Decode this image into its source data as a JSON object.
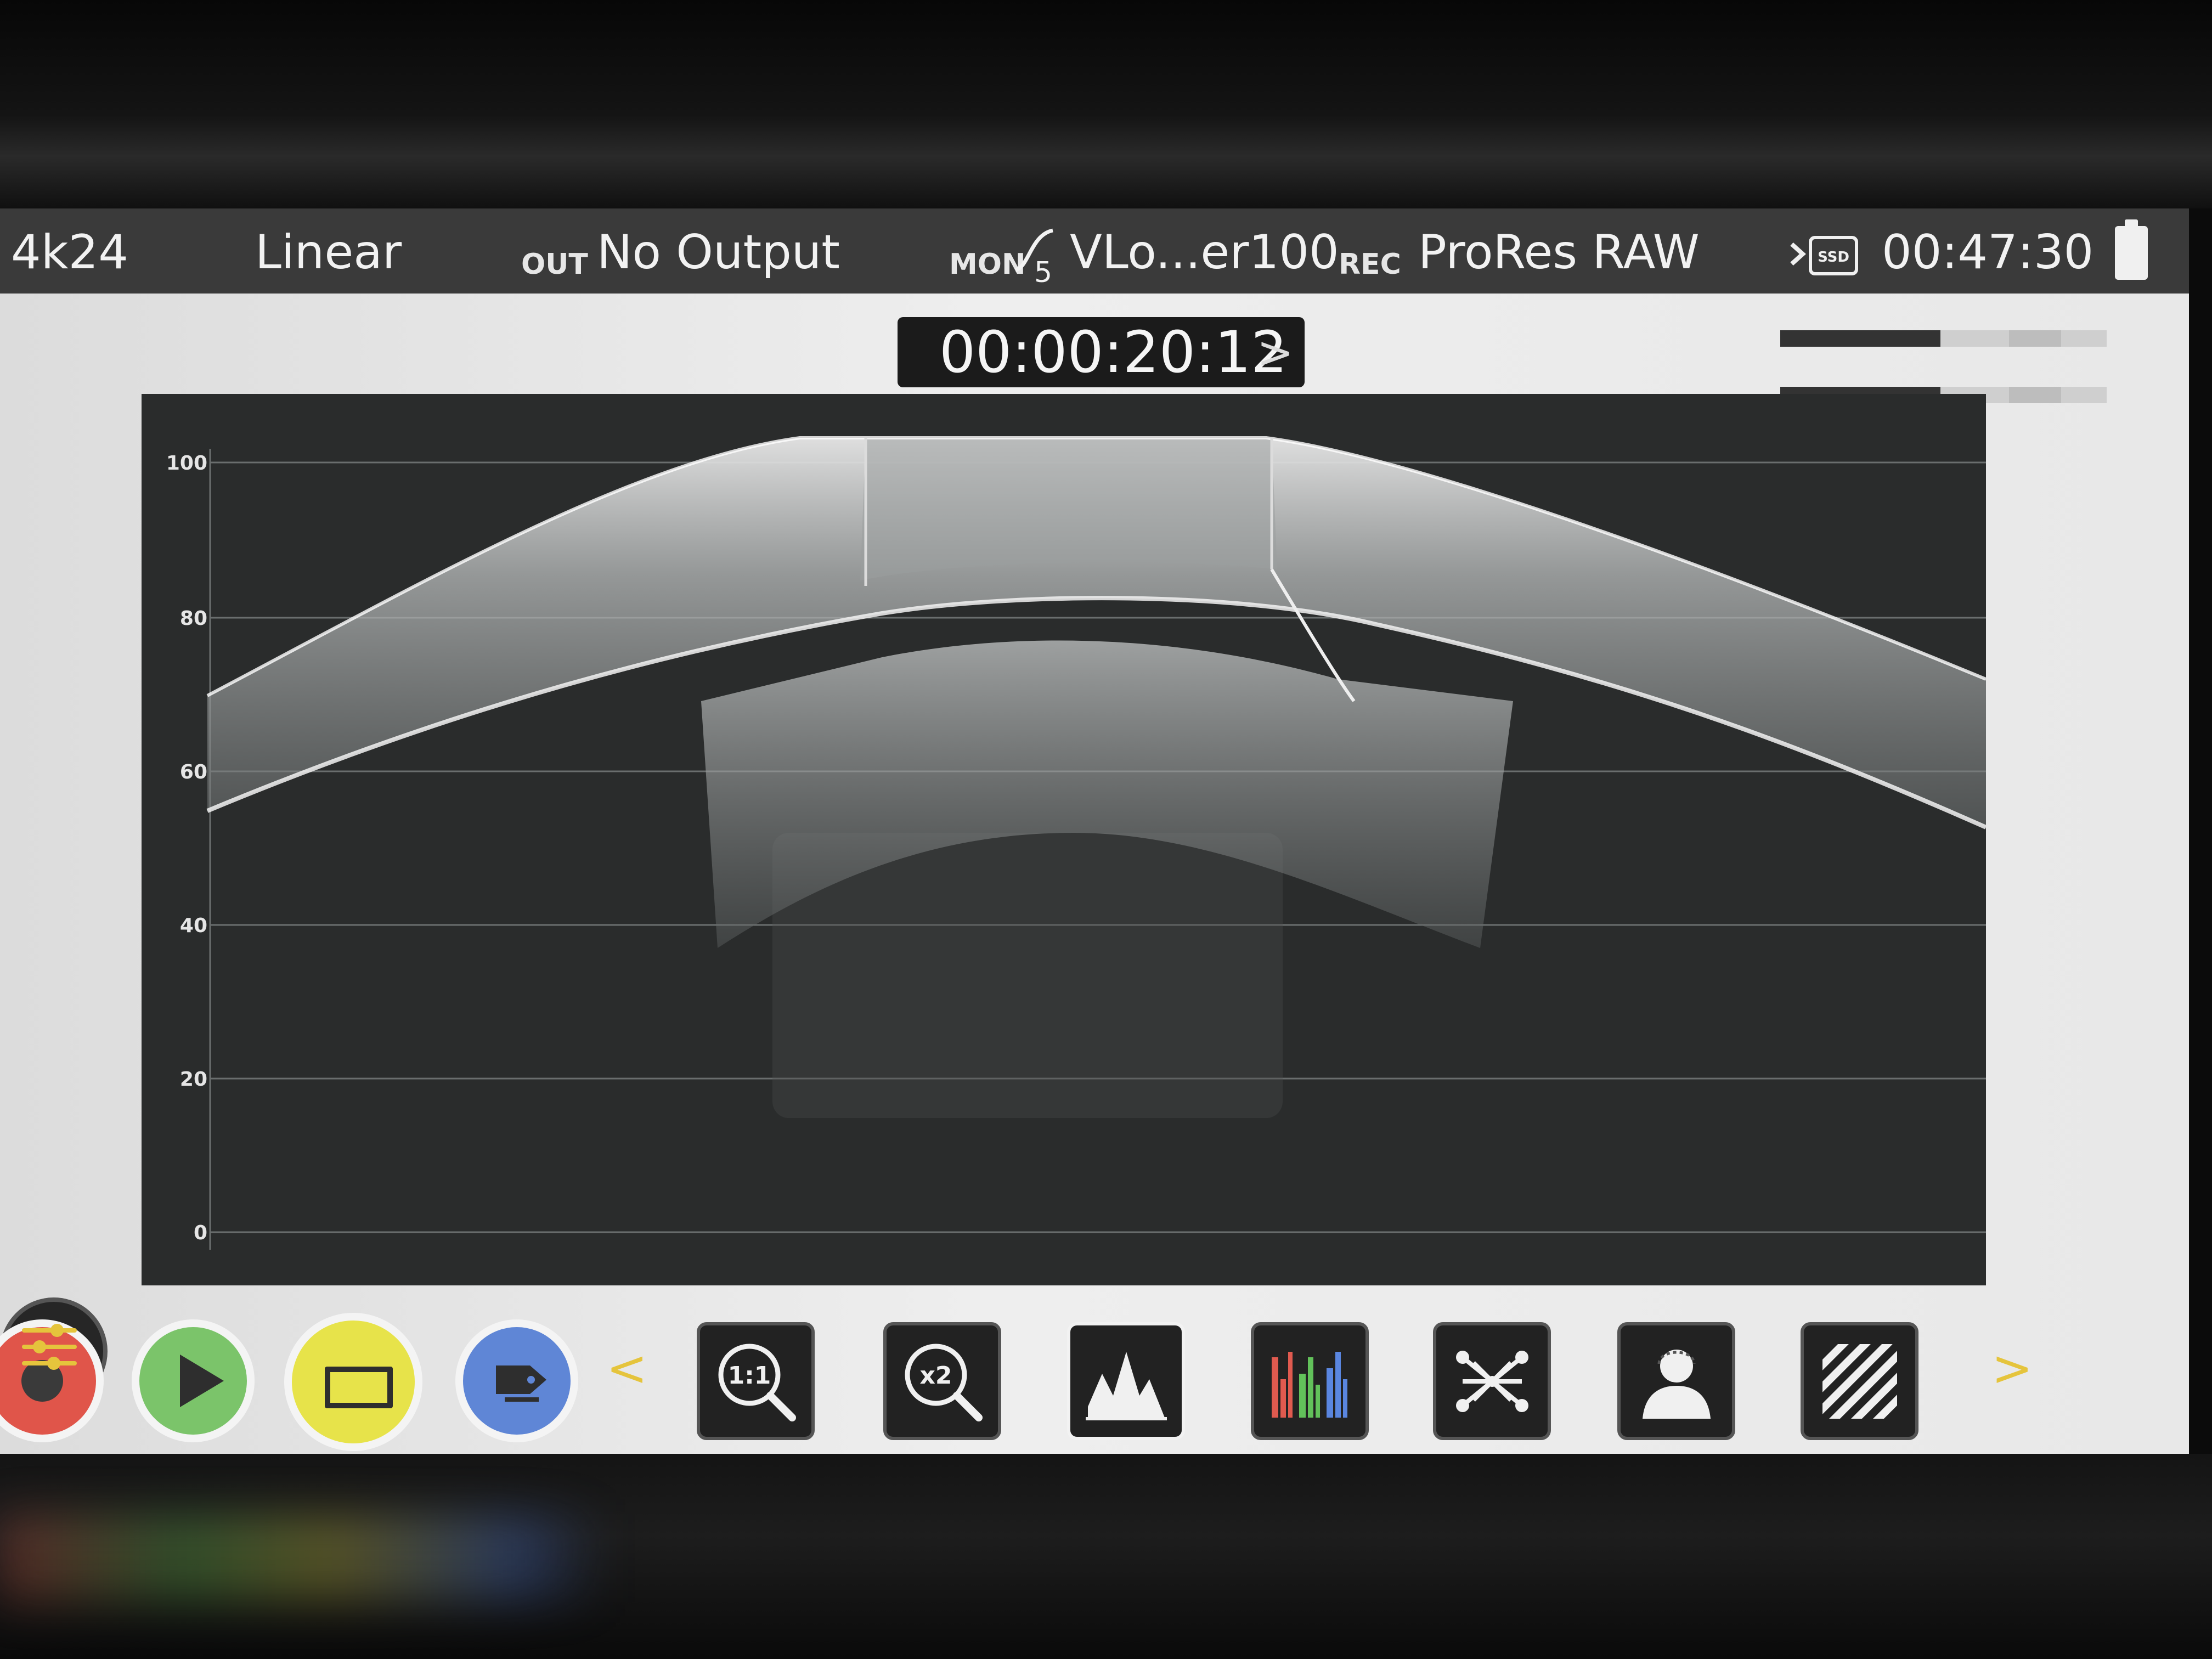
{
  "status_bar": {
    "resolution": "4k24",
    "gamma": "Linear",
    "out_label": "OUT",
    "output": "No Output",
    "mon_label": "MON",
    "curve_index": "5",
    "monitor_mode": "VLo...er100",
    "rec_label": "REC",
    "codec": "ProRes RAW",
    "ssd_label": "SSD",
    "remaining_time": "00:47:30",
    "ssd_icon": "ssd-icon",
    "battery_icon": "battery-icon"
  },
  "timecode": {
    "value": "00:00:20:12",
    "chevron": ">"
  },
  "audio_meters": [
    {
      "level": 0.49
    },
    {
      "level": 0.49
    }
  ],
  "waveform": {
    "scale_labels": [
      "100",
      "80",
      "60",
      "40",
      "20",
      "0"
    ]
  },
  "toolbar": {
    "record_icon": "record-icon",
    "play_icon": "play-icon",
    "display_icon": "display-icon",
    "tag_icon": "tag-icon",
    "left_chevron": "<",
    "right_chevron": ">",
    "tools": [
      {
        "name": "zoom-1to1",
        "label": "1:1"
      },
      {
        "name": "zoom-x2",
        "label": "x2"
      },
      {
        "name": "waveform",
        "icon": "waveform-icon"
      },
      {
        "name": "rgb-parade",
        "icon": "rgb-parade-icon"
      },
      {
        "name": "vectorscope",
        "icon": "vectorscope-icon"
      },
      {
        "name": "false-color",
        "icon": "false-color-icon"
      },
      {
        "name": "zebra",
        "icon": "zebra-icon"
      }
    ],
    "settings_icon": "settings-sliders-icon",
    "colors": {
      "record": "#e0554a",
      "play": "#7bc46a",
      "display": "#e7e34a",
      "tag": "#5f86d6",
      "accent": "#e5c43c"
    }
  }
}
